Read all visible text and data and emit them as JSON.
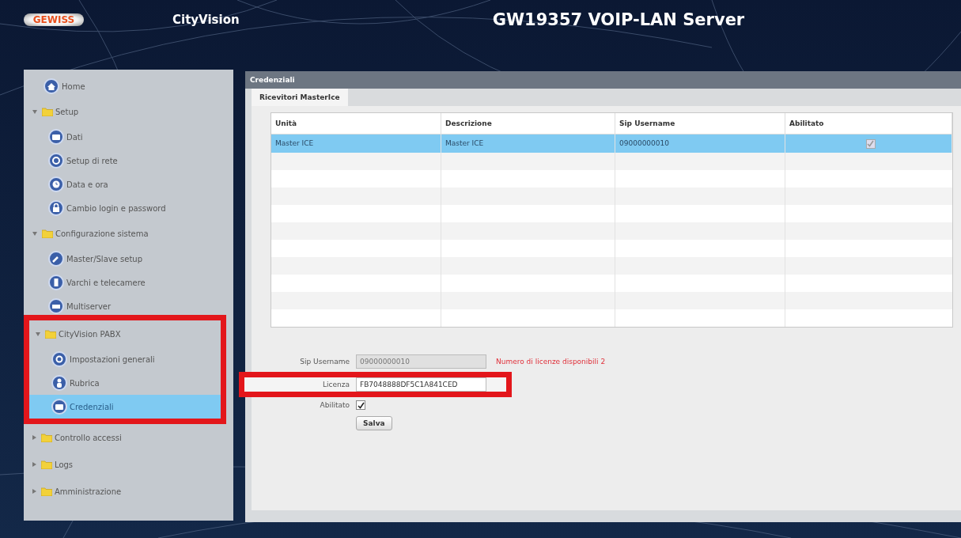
{
  "header": {
    "logo": "GEWISS",
    "app_name": "CityVision",
    "title": "GW19357 VOIP-LAN Server"
  },
  "sidebar": {
    "items": [
      {
        "kind": "page",
        "label": "Home",
        "selected": false
      },
      {
        "kind": "folder",
        "label": "Setup",
        "expanded": true,
        "highlighted": false,
        "children": [
          {
            "kind": "page",
            "label": "Dati",
            "selected": false
          },
          {
            "kind": "page",
            "label": "Setup di rete",
            "selected": false
          },
          {
            "kind": "page",
            "label": "Data e ora",
            "selected": false
          },
          {
            "kind": "page",
            "label": "Cambio login e password",
            "selected": false
          }
        ]
      },
      {
        "kind": "folder",
        "label": "Configurazione sistema",
        "expanded": true,
        "highlighted": false,
        "children": [
          {
            "kind": "page",
            "label": "Master/Slave setup",
            "selected": false
          },
          {
            "kind": "page",
            "label": "Varchi e telecamere",
            "selected": false
          },
          {
            "kind": "page",
            "label": "Multiserver",
            "selected": false
          }
        ]
      },
      {
        "kind": "folder",
        "label": "CityVision PABX",
        "expanded": true,
        "highlighted": true,
        "children": [
          {
            "kind": "page",
            "label": "Impostazioni generali",
            "selected": false
          },
          {
            "kind": "page",
            "label": "Rubrica",
            "selected": false
          },
          {
            "kind": "page",
            "label": "Credenziali",
            "selected": true
          }
        ]
      },
      {
        "kind": "folder",
        "label": "Controllo accessi",
        "expanded": false,
        "highlighted": false
      },
      {
        "kind": "folder",
        "label": "Logs",
        "expanded": false,
        "highlighted": false
      },
      {
        "kind": "folder",
        "label": "Amministrazione",
        "expanded": false,
        "highlighted": false
      }
    ]
  },
  "panel": {
    "title": "Credenziali",
    "tabs": [
      {
        "label": "Ricevitori MasterIce",
        "selected": true
      }
    ],
    "table": {
      "columns": [
        "Unità",
        "Descrizione",
        "Sip Username",
        "Abilitato"
      ],
      "rows": [
        {
          "unit": "Master ICE",
          "description": "Master ICE",
          "sip_username": "09000000010",
          "enabled": true,
          "selected": true
        }
      ]
    },
    "form": {
      "sip_username": {
        "label": "Sip Username",
        "value": "09000000010",
        "disabled": true
      },
      "license_note": "Numero di licenze disponibili  2",
      "license": {
        "label": "Licenza",
        "value": "FB7048888DF5C1A841CED",
        "highlighted": true
      },
      "enabled": {
        "label": "Abilitato",
        "checked": true
      },
      "save_button": "Salva"
    }
  }
}
